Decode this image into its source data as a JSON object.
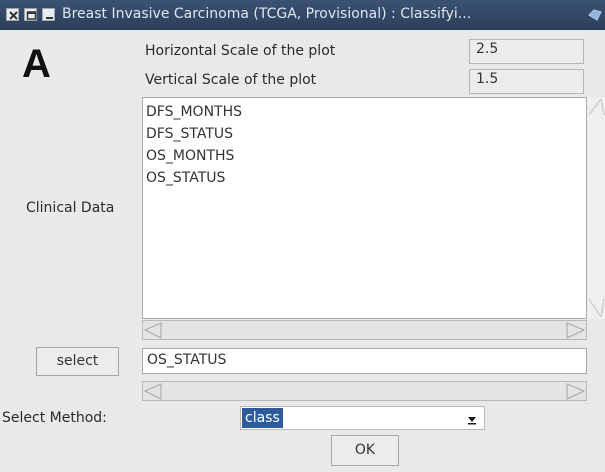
{
  "window": {
    "title": "Breast Invasive Carcinoma (TCGA, Provisional) : Classifyi..."
  },
  "panel_label": "A",
  "horizontal_scale": {
    "label": "Horizontal Scale of the plot",
    "value": "2.5"
  },
  "vertical_scale": {
    "label": "Vertical Scale of the plot",
    "value": "1.5"
  },
  "clinical_data": {
    "label": "Clinical Data",
    "items": [
      "DFS_MONTHS",
      "DFS_STATUS",
      "OS_MONTHS",
      "OS_STATUS"
    ]
  },
  "select_button_label": "select",
  "selected_field_value": "OS_STATUS",
  "select_method": {
    "label": "Select Method:",
    "value": "class"
  },
  "ok_button_label": "OK",
  "icons": [
    "close-icon",
    "maximize-icon",
    "minimize-icon",
    "app-icon",
    "scroll-up-arrow-icon",
    "scroll-down-arrow-icon",
    "scroll-left-arrow-icon",
    "scroll-right-arrow-icon",
    "dropdown-arrow-icon"
  ],
  "colors": {
    "titlebar": "#2c3f5b",
    "selection": "#2d5b9c",
    "window_bg": "#e9e9e9"
  }
}
